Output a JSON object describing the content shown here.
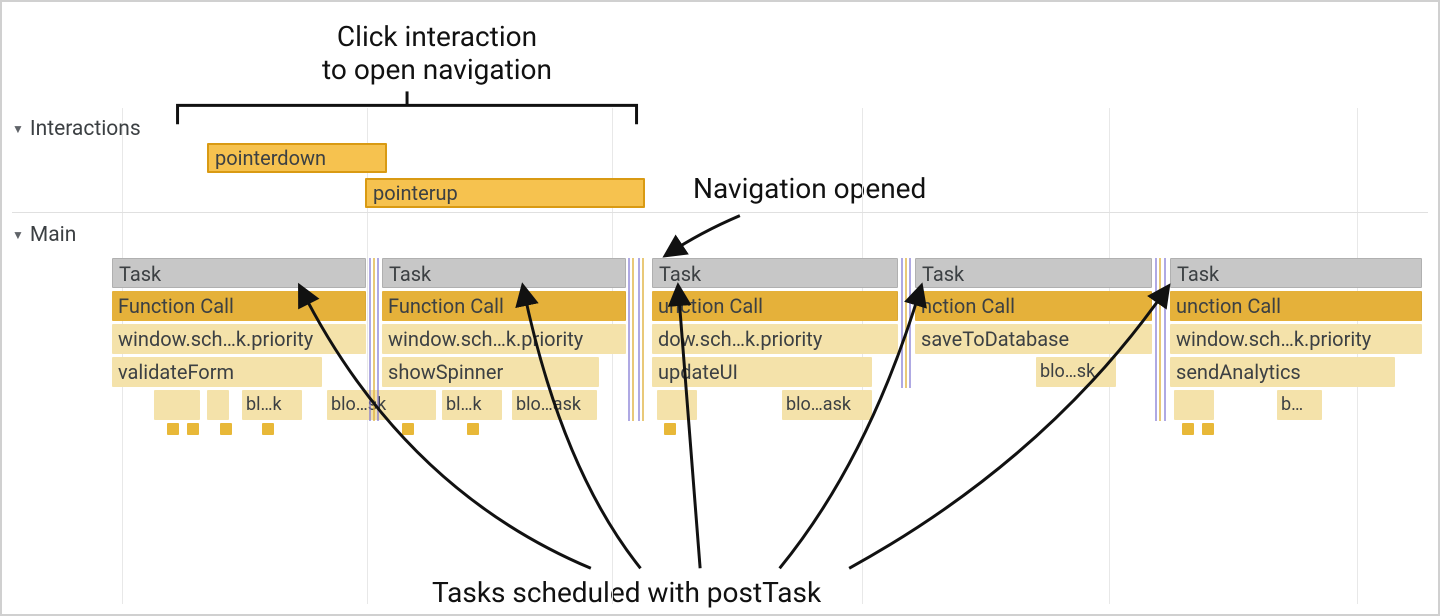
{
  "annotations": {
    "top_line1": "Click interaction",
    "top_line2": "to open navigation",
    "right": "Navigation opened",
    "bottom": "Tasks scheduled with postTask"
  },
  "tracks": {
    "interactions_label": "Interactions",
    "main_label": "Main"
  },
  "events": {
    "pointerdown": "pointerdown",
    "pointerup": "pointerup",
    "task": "Task",
    "function_call": "Function Call",
    "window_sched": "window.sch…k.priority",
    "validate": "validateForm",
    "showSpinner": "showSpinner",
    "updateUI": "updateUI",
    "saveToDatabase": "saveToDatabase",
    "sendAnalytics": "sendAnalytics",
    "bl_k": "bl…k",
    "blo_sk": "blo…sk",
    "blo_ask": "blo…ask",
    "b": "b…",
    "dow": "dow.sch…k.priority",
    "nction": "nction Call",
    "unction": "unction Call"
  }
}
